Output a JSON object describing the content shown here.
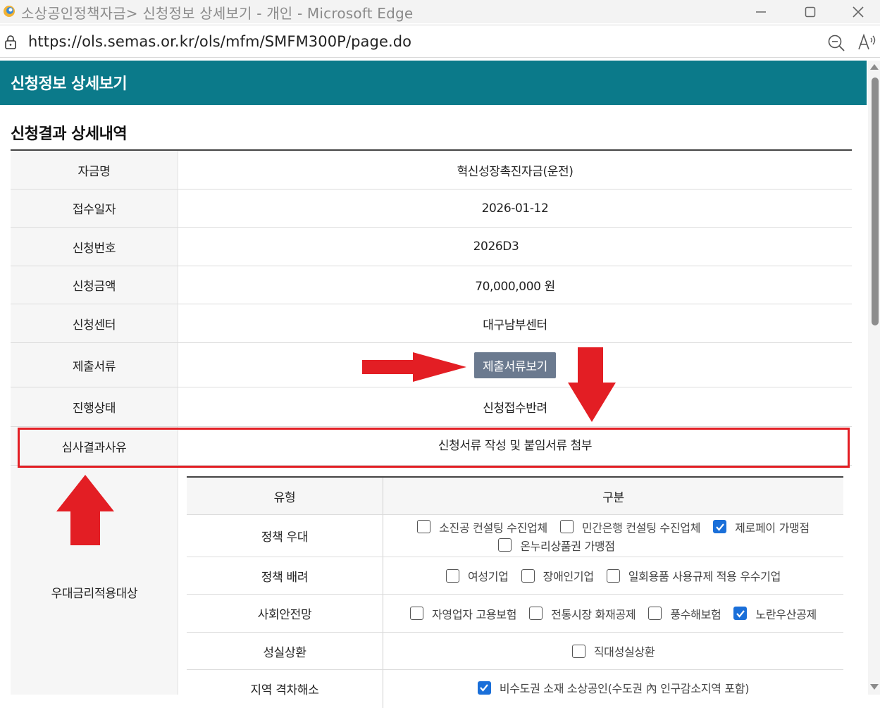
{
  "window": {
    "title": "소상공인정책자금> 신청정보 상세보기 - 개인 - Microsoft Edge",
    "url": "https://ols.semas.or.kr/ols/mfm/SMFM300P/page.do"
  },
  "page": {
    "header_title": "신청정보 상세보기",
    "section_title": "신청결과 상세내역"
  },
  "details": [
    {
      "label": "자금명",
      "value": "혁신성장촉진자금(운전)"
    },
    {
      "label": "접수일자",
      "value": "2026-01-12"
    },
    {
      "label": "신청번호",
      "value": "2026D3"
    },
    {
      "label": "신청금액",
      "value": "70,000,000 원"
    },
    {
      "label": "신청센터",
      "value": "대구남부센터"
    },
    {
      "label": "제출서류",
      "button_label": "제출서류보기"
    },
    {
      "label": "진행상태",
      "value": "신청접수반려"
    },
    {
      "label": "심사결과사유",
      "value": "신청서류 작성 및 붙임서류 첨부"
    }
  ],
  "preferential": {
    "label": "우대금리적용대상",
    "header": {
      "type": "유형",
      "category": "구분"
    },
    "rows": [
      {
        "type": "정책 우대",
        "options": [
          {
            "label": "소진공 컨설팅 수진업체",
            "checked": false
          },
          {
            "label": "민간은행 컨설팅 수진업체",
            "checked": false
          },
          {
            "label": "제로페이 가맹점",
            "checked": true
          },
          {
            "label": "온누리상품권 가맹점",
            "checked": false
          }
        ]
      },
      {
        "type": "정책 배려",
        "options": [
          {
            "label": "여성기업",
            "checked": false
          },
          {
            "label": "장애인기업",
            "checked": false
          },
          {
            "label": "일회용품 사용규제 적용 우수기업",
            "checked": false
          }
        ]
      },
      {
        "type": "사회안전망",
        "options": [
          {
            "label": "자영업자 고용보험",
            "checked": false
          },
          {
            "label": "전통시장 화재공제",
            "checked": false
          },
          {
            "label": "풍수해보험",
            "checked": false
          },
          {
            "label": "노란우산공제",
            "checked": true
          }
        ]
      },
      {
        "type": "성실상환",
        "options": [
          {
            "label": "직대성실상환",
            "checked": false
          }
        ]
      },
      {
        "type": "지역 격차해소",
        "options": [
          {
            "label": "비수도권 소재 소상공인(수도권 內 인구감소지역 포함)",
            "checked": true
          }
        ]
      }
    ]
  },
  "colors": {
    "header_bg": "#0b7a8a",
    "annotation_red": "#e31e24",
    "button_bg": "#6b7a8f",
    "checkbox_checked": "#1a6fd9"
  }
}
